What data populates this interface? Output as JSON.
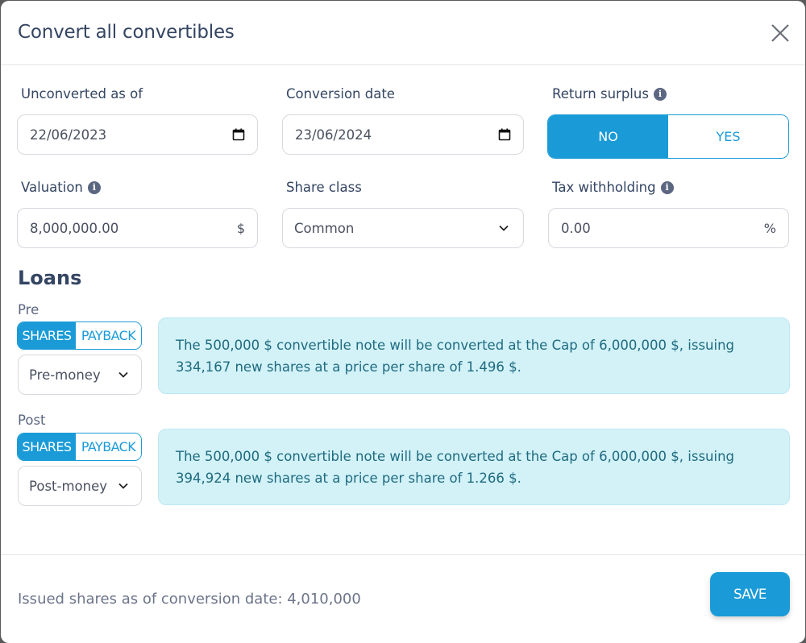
{
  "modal": {
    "title": "Convert all convertibles",
    "close_icon": "close-icon"
  },
  "fields": {
    "unconverted_as_of": {
      "label": "Unconverted as of",
      "value": "22/06/2023",
      "icon": "calendar-icon"
    },
    "conversion_date": {
      "label": "Conversion date",
      "value": "23/06/2024",
      "icon": "calendar-icon"
    },
    "return_surplus": {
      "label": "Return surplus",
      "info_icon": "info-icon",
      "options": [
        "NO",
        "YES"
      ],
      "selected": "NO"
    },
    "valuation": {
      "label": "Valuation",
      "value": "8,000,000.00",
      "suffix": "$",
      "info_icon": "info-icon"
    },
    "share_class": {
      "label": "Share class",
      "value": "Common",
      "icon": "chevron-down-icon"
    },
    "tax_withholding": {
      "label": "Tax withholding",
      "value": "0.00",
      "suffix": "%",
      "info_icon": "info-icon"
    }
  },
  "loans": {
    "title": "Loans",
    "items": [
      {
        "label": "Pre",
        "toggle": {
          "options": [
            "SHARES",
            "PAYBACK"
          ],
          "selected": "SHARES"
        },
        "money_type": "Pre-money",
        "message": "The 500,000 $ convertible note will be converted at the Cap of 6,000,000 $, issuing 334,167 new shares at a price per share of 1.496 $."
      },
      {
        "label": "Post",
        "toggle": {
          "options": [
            "SHARES",
            "PAYBACK"
          ],
          "selected": "SHARES"
        },
        "money_type": "Post-money",
        "message": "The 500,000 $ convertible note will be converted at the Cap of 6,000,000 $, issuing 394,924 new shares at a price per share of 1.266 $."
      }
    ]
  },
  "footer": {
    "issued_shares_text": "Issued shares as of conversion date: 4,010,000",
    "save_label": "SAVE"
  },
  "colors": {
    "accent": "#1a9bd7",
    "info_bg": "#d2f2f8",
    "title_text": "#344563"
  }
}
